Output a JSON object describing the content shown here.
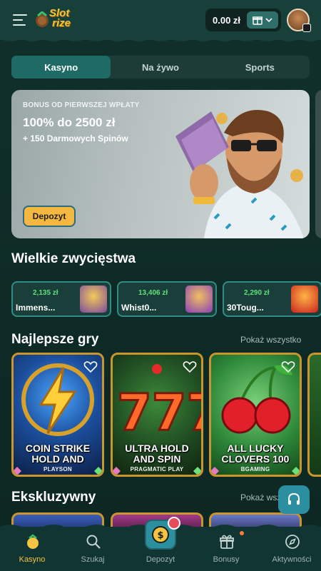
{
  "header": {
    "logo_text": "Slot\nrize",
    "balance": "0.00 zł"
  },
  "tabs": [
    {
      "label": "Kasyno",
      "active": true
    },
    {
      "label": "Na żywo",
      "active": false
    },
    {
      "label": "Sports",
      "active": false
    }
  ],
  "banner": {
    "kicker": "BONUS OD PIERWSZEJ WPŁATY",
    "title": "100% do 2500 zł",
    "subtitle": "+ 150 Darmowych Spinów",
    "button": "Depozyt"
  },
  "big_wins": {
    "title": "Wielkie zwycięstwa",
    "items": [
      {
        "amount": "2,135 zł",
        "name": "Immens..."
      },
      {
        "amount": "13,406 zł",
        "name": "Whist0..."
      },
      {
        "amount": "2,290 zł",
        "name": "30Toug..."
      }
    ]
  },
  "top_games": {
    "title": "Najlepsze gry",
    "show_all": "Pokaż wszystko",
    "items": [
      {
        "title_line1": "COIN STRIKE",
        "title_line2": "HOLD AND",
        "provider": "PLAYSON"
      },
      {
        "title_line1": "ULTRA HOLD",
        "title_line2": "AND SPIN",
        "provider": "PRAGMATIC PLAY"
      },
      {
        "title_line1": "ALL LUCKY",
        "title_line2": "CLOVERS 100",
        "provider": "BGAMING"
      }
    ]
  },
  "exclusive": {
    "title": "Ekskluzywny",
    "show_all": "Pokaż wszystko"
  },
  "bottom_nav": [
    {
      "label": "Kasyno",
      "icon": "casino-icon",
      "active": true
    },
    {
      "label": "Szukaj",
      "icon": "search-icon",
      "active": false
    },
    {
      "label": "Depozyt",
      "icon": "deposit-icon",
      "active": false
    },
    {
      "label": "Bonusy",
      "icon": "gift-icon",
      "active": false
    },
    {
      "label": "Aktywności",
      "icon": "compass-icon",
      "active": false
    }
  ],
  "colors": {
    "background": "#0f2a26",
    "accent": "#f4c542",
    "tab_active": "#1e6b66",
    "win_amount": "#5ee07b"
  }
}
